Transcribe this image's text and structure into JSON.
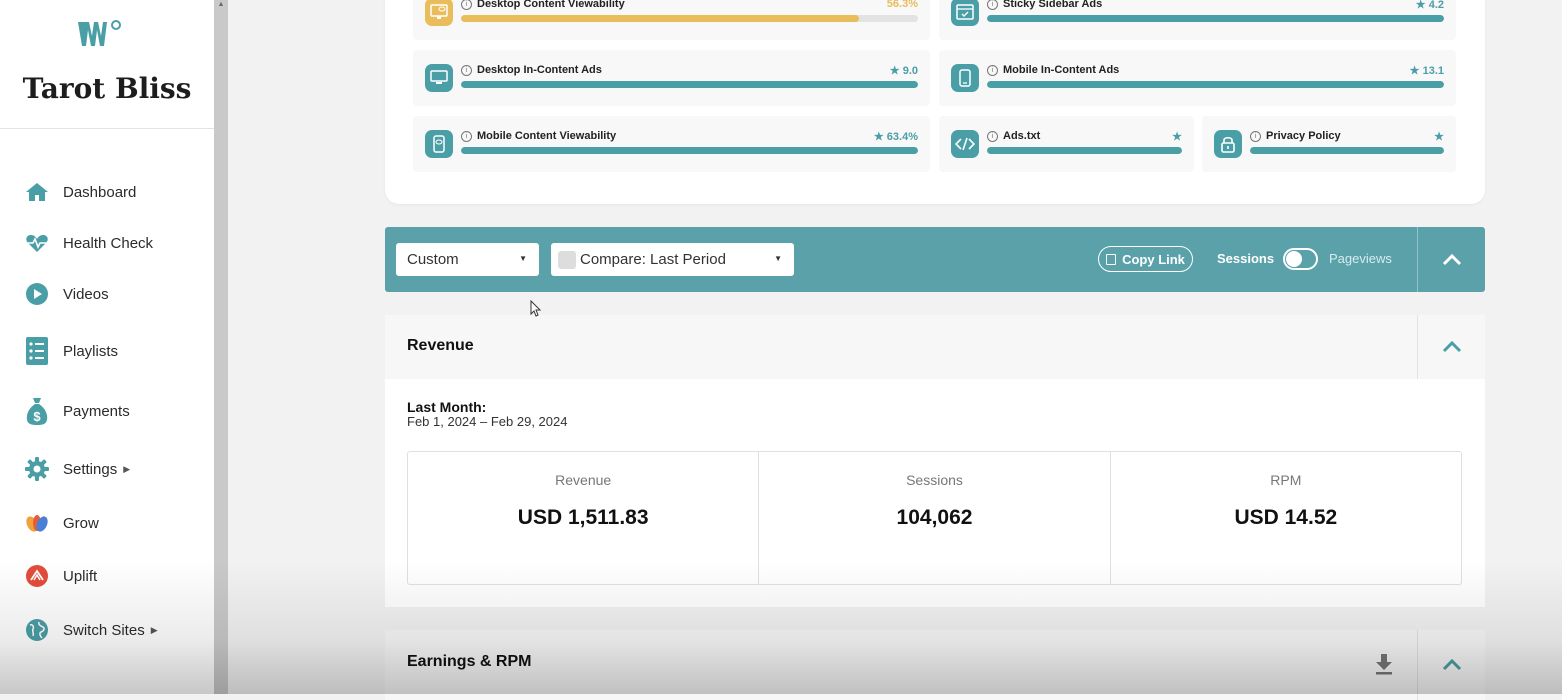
{
  "sidebar": {
    "site_name": "Tarot Bliss",
    "items": [
      {
        "label": "Dashboard",
        "icon": "home-icon"
      },
      {
        "label": "Health Check",
        "icon": "heartbeat-icon"
      },
      {
        "label": "Videos",
        "icon": "play-circle-icon"
      },
      {
        "label": "Playlists",
        "icon": "list-icon"
      },
      {
        "label": "Payments",
        "icon": "money-bag-icon"
      },
      {
        "label": "Settings",
        "icon": "gear-icon",
        "has_submenu": true
      },
      {
        "label": "Grow",
        "icon": "grow-icon"
      },
      {
        "label": "Uplift",
        "icon": "uplift-icon"
      },
      {
        "label": "Switch Sites",
        "icon": "globe-icon",
        "has_submenu": true
      }
    ]
  },
  "metrics": [
    {
      "label": "Desktop Content Viewability",
      "score": "56.3%",
      "fill": 0.87,
      "status": "warning",
      "icon": "desktop-eye-icon"
    },
    {
      "label": "Sticky Sidebar Ads",
      "score": "4.2",
      "fill": 1.0,
      "status": "good",
      "icon": "sidebar-check-icon"
    },
    {
      "label": "Desktop In-Content Ads",
      "score": "9.0",
      "fill": 1.0,
      "status": "good",
      "icon": "desktop-icon"
    },
    {
      "label": "Mobile In-Content Ads",
      "score": "13.1",
      "fill": 1.0,
      "status": "good",
      "icon": "mobile-icon"
    },
    {
      "label": "Mobile Content Viewability",
      "score": "63.4%",
      "fill": 1.0,
      "status": "good",
      "icon": "mobile-eye-icon"
    },
    {
      "label": "Ads.txt",
      "score": "",
      "fill": 1.0,
      "status": "good",
      "icon": "code-icon"
    },
    {
      "label": "Privacy Policy",
      "score": "",
      "fill": 1.0,
      "status": "good",
      "icon": "lock-icon"
    }
  ],
  "toolbar": {
    "date_range": "Custom",
    "compare": "Compare: Last Period",
    "copy_link": "Copy Link",
    "toggle_left": "Sessions",
    "toggle_right": "Pageviews"
  },
  "revenue": {
    "title": "Revenue",
    "period_label": "Last Month:",
    "period_range": "Feb 1, 2024 – Feb 29, 2024",
    "stats": [
      {
        "label": "Revenue",
        "value": "USD 1,511.83"
      },
      {
        "label": "Sessions",
        "value": "104,062"
      },
      {
        "label": "RPM",
        "value": "USD 14.52"
      }
    ]
  },
  "earnings": {
    "title": "Earnings & RPM"
  },
  "colors": {
    "accent": "#5ba1aa",
    "teal": "#4a9ea6",
    "warning": "#e9bd5c"
  }
}
